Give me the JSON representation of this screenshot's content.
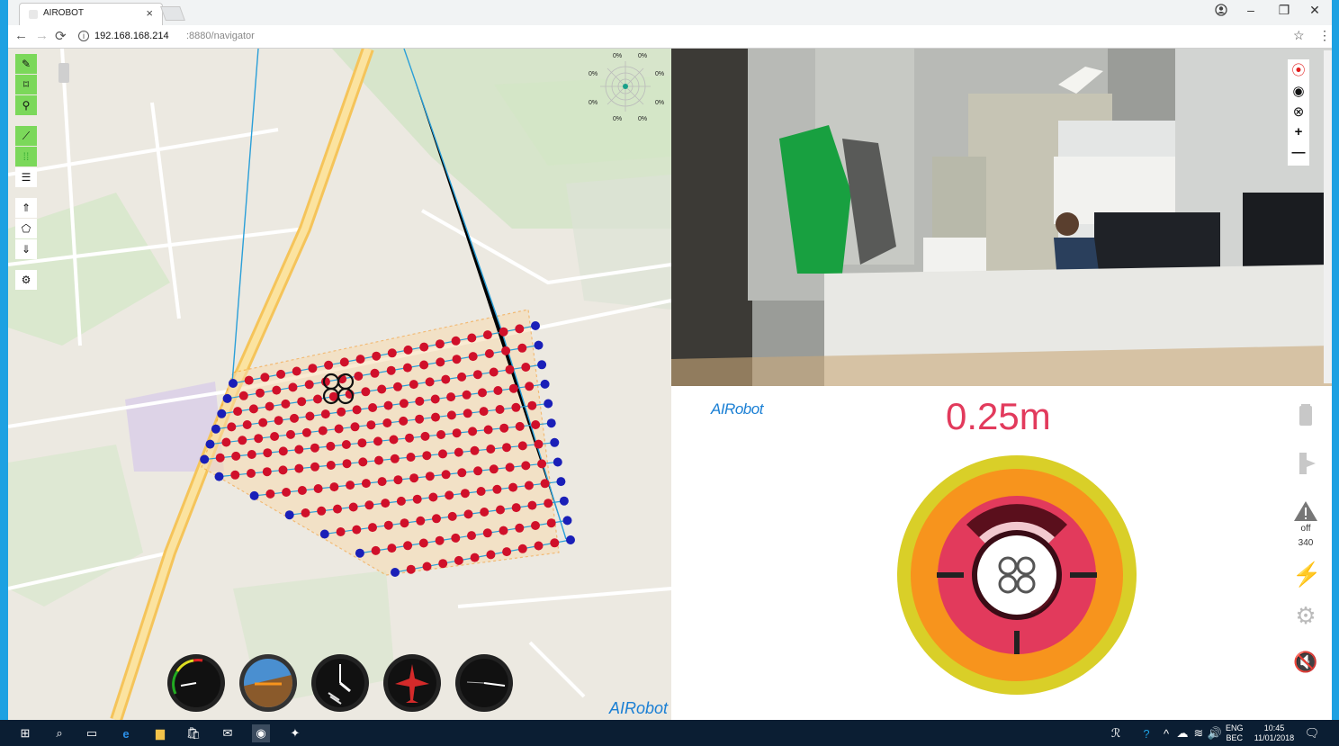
{
  "browser": {
    "tab_title": "AIROBOT",
    "url_host": "192.168.168.214",
    "url_rest": ":8880/navigator"
  },
  "map": {
    "compass_percent": [
      "0%",
      "0%",
      "0%",
      "0%",
      "0%",
      "0%",
      "0%",
      "0%"
    ],
    "logo": "AIRobot"
  },
  "info": {
    "logo": "AIRobot",
    "altitude": "0.25m",
    "warning_state": "off",
    "warning_value": "340"
  },
  "taskbar": {
    "lang_line1": "ENG",
    "lang_line2": "BEC",
    "time": "10:45",
    "date": "11/01/2018"
  },
  "colors": {
    "accent_green": "#7bd85a",
    "waypoint_red": "#d0102a",
    "waypoint_blue": "#1a1fb8",
    "route_line": "#2a9fd8",
    "altitude_text": "#e23a5c",
    "gauge_outer": "#d9cf28",
    "gauge_mid": "#f7941d",
    "gauge_inner": "#e23a5c"
  }
}
